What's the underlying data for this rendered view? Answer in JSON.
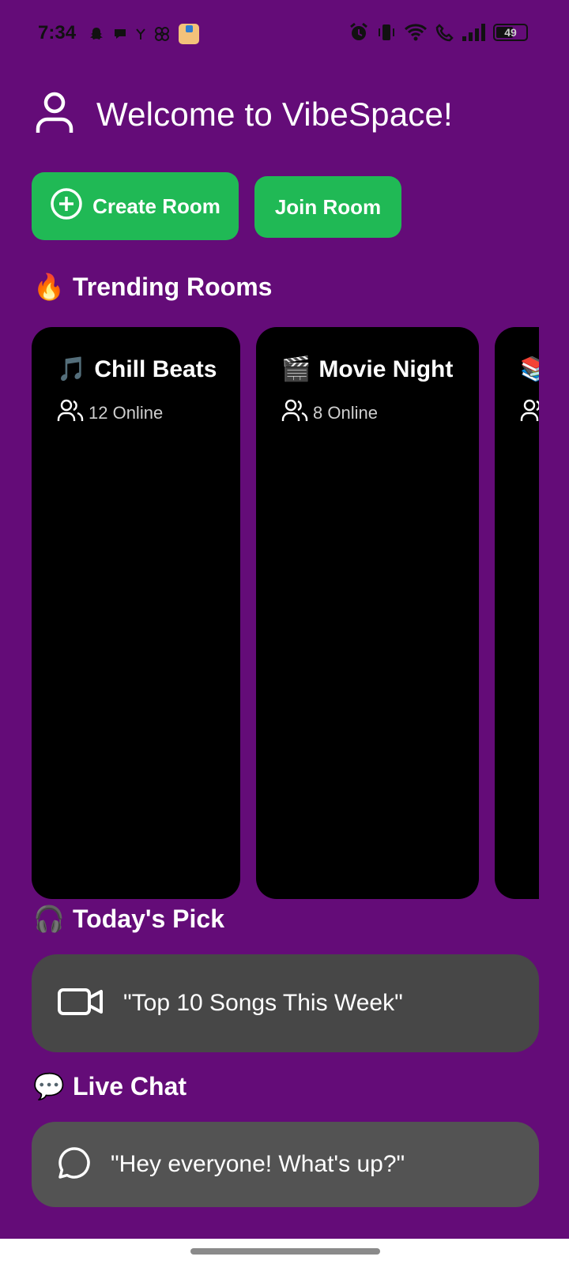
{
  "status_bar": {
    "time": "7:34",
    "left_icons": [
      "snapchat-icon",
      "chat-bubble-icon",
      "signal-small-icon",
      "pinwheel-icon",
      "amazon-icon"
    ],
    "right_icons": [
      "alarm-icon",
      "vibrate-icon",
      "wifi-icon",
      "wifi-call-icon",
      "cell-signal-icon",
      "battery-icon"
    ],
    "battery_level": "49"
  },
  "header": {
    "icon": "user-icon",
    "title": "Welcome to VibeSpace!"
  },
  "actions": {
    "create_label": "Create Room",
    "create_icon": "plus-circle-icon",
    "join_label": "Join Room"
  },
  "trending": {
    "emoji": "🔥",
    "title": "Trending Rooms",
    "rooms": [
      {
        "emoji": "🎵",
        "name": "Chill Beats",
        "online": "12 Online"
      },
      {
        "emoji": "🎬",
        "name": "Movie Night",
        "online": "8 Online"
      },
      {
        "emoji": "📚",
        "name": "",
        "online": ""
      }
    ]
  },
  "todays_pick": {
    "emoji": "🎧",
    "title": "Today's Pick",
    "icon": "video-icon",
    "text": "\"Top 10 Songs This Week\""
  },
  "live_chat": {
    "emoji": "💬",
    "title": "Live Chat",
    "icon": "chat-icon",
    "text": "\"Hey everyone! What's up?\""
  },
  "colors": {
    "background": "#640c78",
    "accent": "#20b955",
    "card": "#000000",
    "pick_card": "#474747",
    "chat_card": "#535353"
  }
}
